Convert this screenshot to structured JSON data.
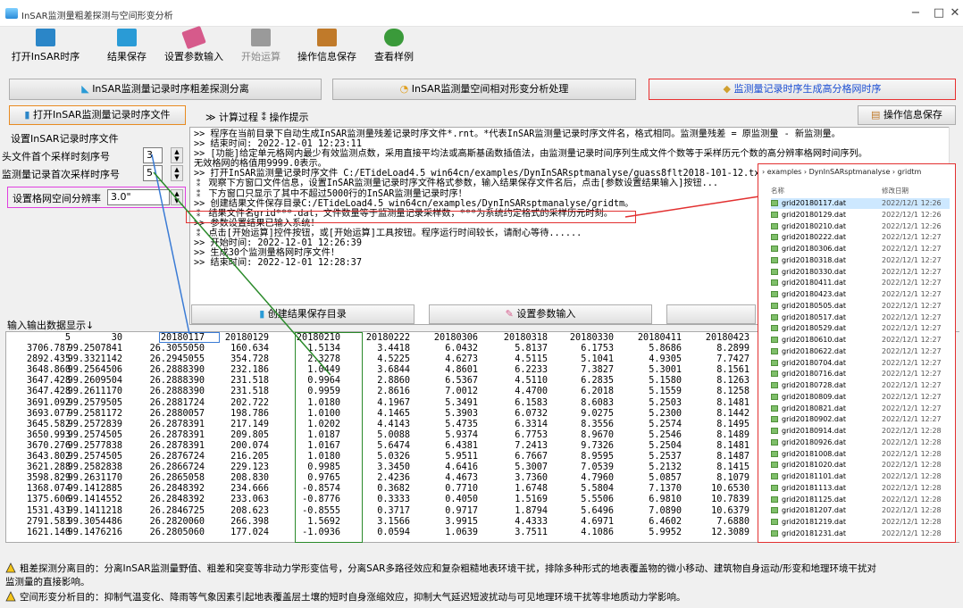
{
  "window": {
    "title": "InSAR监测量粗差探测与空间形变分析",
    "min": "−",
    "max": "□",
    "close": "✕"
  },
  "toolbar": [
    {
      "label": "打开InSAR时序",
      "icon": "book-icon",
      "color": "#2b86c8",
      "disabled": false
    },
    {
      "label": "结果保存",
      "icon": "save-icon",
      "color": "#2a9bd6",
      "disabled": false
    },
    {
      "label": "设置参数输入",
      "icon": "pencil-icon",
      "color": "#d65a8b",
      "disabled": false
    },
    {
      "label": "开始运算",
      "icon": "run-icon",
      "color": "#9a9a9a",
      "disabled": true
    },
    {
      "label": "操作信息保存",
      "icon": "doc-save-icon",
      "color": "#c07a2a",
      "disabled": false
    },
    {
      "label": "查看样例",
      "icon": "people-icon",
      "color": "#3a9a3a",
      "disabled": false
    }
  ],
  "tabs": [
    {
      "label": "InSAR监测量记录时序粗差探测分离"
    },
    {
      "label": "InSAR监测量空间相对形变分析处理"
    },
    {
      "label": "监测量记录时序生成高分格网时序"
    }
  ],
  "panel": {
    "open_button": "打开InSAR监测量记录时序文件",
    "breadcrumb": "≫ 计算过程 ⁑ 操作提示",
    "save_info_button": "操作信息保存",
    "section_title": "设置InSAR记录时序文件",
    "first_label": "头文件首个采样时刻序号",
    "first_value": "3",
    "second_label": "监测量记录首次采样时序号",
    "second_value": "5",
    "resolution_label": "设置格网空间分辨率",
    "resolution_value": "3.0\"",
    "io_label": "输入输出数据显示↓",
    "create_dir_button": "创建结果保存目录",
    "set_param_button": "设置参数输入"
  },
  "log": [
    ">> 程序在当前目录下自动生成InSAR监测量残差记录时序文件*.rnt。*代表InSAR监测量记录时序文件名，格式相同。监测量残差 = 原监测量 - 新监测量。",
    ">> 结束时间: 2022-12-01 12:23:11",
    ">> [功能]给定单元格网内最少有效监测点数，采用直接平均法或高斯基函数插值法，由监测量记录时间序列生成文件个数等于采样历元个数的高分辨率格网时间序列。",
    "无效格网的格值用9999.0表示。",
    ">> 打开InSAR监测量记录时序文件 C:/ETideLoad4.5_win64cn/examples/DynInSARsptmanalyse/guass8flt2018-101-12.txt。",
    " ⁑ 观察下方窗口文件信息，设置InSAR监测量记录时序文件格式参数，输入结果保存文件名后，点击[参数设置结果输入]按钮...",
    " ⁑ 下方窗口只显示了其中不超过5000行的InSAR监测量记录时序！",
    ">> 创建结果文件保存目录C:/ETideLoad4.5_win64cn/examples/DynInSARsptmanalyse/gridtm。",
    " ⁑ 结果文件名grid***.dat，文件数量等于监测量记录采样数，***为系统约定格式的采样历元时刻。",
    ">> 参数设置结果已输入系统！",
    " ⁑ 点击[开始运算]控件按钮，或[开始运算]工具按钮。程序运行时间较长，请耐心等待......",
    ">> 开始时间: 2022-12-01 12:26:39",
    ">> 生成30个监测量格网时序文件！",
    ">> 结束时间: 2022-12-01 12:28:37"
  ],
  "table": {
    "header": [
      "5",
      "30",
      "20180117",
      "20180129",
      "20180210",
      "20180222",
      "20180306",
      "20180318",
      "20180330",
      "20180411",
      "20180423"
    ],
    "rows": [
      [
        "3706.787",
        "99.2507841",
        "26.3055050",
        "160.634",
        "1.5134",
        "3.4418",
        "6.0432",
        "5.8137",
        "6.1753",
        "5.8686",
        "8.2899"
      ],
      [
        "2892.435",
        "99.3321142",
        "26.2945055",
        "354.728",
        "2.3278",
        "4.5225",
        "4.6273",
        "4.5115",
        "5.1041",
        "4.9305",
        "7.7427"
      ],
      [
        "3648.860",
        "99.2564506",
        "26.2888390",
        "232.186",
        "1.0449",
        "3.6844",
        "4.8601",
        "6.2233",
        "7.3827",
        "5.3001",
        "8.1561"
      ],
      [
        "3647.428",
        "99.2609504",
        "26.2888390",
        "231.518",
        "0.9964",
        "2.8860",
        "6.5367",
        "4.5110",
        "6.2835",
        "5.1580",
        "8.1263"
      ],
      [
        "3647.428",
        "99.2611170",
        "26.2888390",
        "231.518",
        "0.9959",
        "2.8616",
        "7.0012",
        "4.4700",
        "6.2018",
        "5.1559",
        "8.1258"
      ],
      [
        "3691.092",
        "99.2579505",
        "26.2881724",
        "202.722",
        "1.0180",
        "4.1967",
        "5.3491",
        "6.1583",
        "8.6083",
        "5.2503",
        "8.1481"
      ],
      [
        "3693.077",
        "99.2581172",
        "26.2880057",
        "198.786",
        "1.0100",
        "4.1465",
        "5.3903",
        "6.0732",
        "9.0275",
        "5.2300",
        "8.1442"
      ],
      [
        "3645.582",
        "99.2572839",
        "26.2878391",
        "217.149",
        "1.0202",
        "4.4143",
        "5.4735",
        "6.3314",
        "8.3556",
        "5.2574",
        "8.1495"
      ],
      [
        "3650.993",
        "99.2574505",
        "26.2878391",
        "209.805",
        "1.0187",
        "5.0088",
        "5.9374",
        "6.7753",
        "8.9670",
        "5.2546",
        "8.1489"
      ],
      [
        "3670.276",
        "99.2577838",
        "26.2878391",
        "200.074",
        "1.0167",
        "5.6474",
        "6.4381",
        "7.2413",
        "9.7326",
        "5.2504",
        "8.1481"
      ],
      [
        "3643.802",
        "99.2574505",
        "26.2876724",
        "216.205",
        "1.0180",
        "5.0326",
        "5.9511",
        "6.7667",
        "8.9595",
        "5.2537",
        "8.1487"
      ],
      [
        "3621.288",
        "99.2582838",
        "26.2866724",
        "229.123",
        "0.9985",
        "3.3450",
        "4.6416",
        "5.3007",
        "7.0539",
        "5.2132",
        "8.1415"
      ],
      [
        "3598.829",
        "99.2631170",
        "26.2865058",
        "208.830",
        "0.9765",
        "2.4236",
        "4.4673",
        "3.7360",
        "4.7960",
        "5.0857",
        "8.1079"
      ],
      [
        "1368.074",
        "99.1412885",
        "26.2848392",
        "234.666",
        "-0.8574",
        "0.3682",
        "0.7710",
        "1.6748",
        "5.5804",
        "7.1370",
        "10.6530"
      ],
      [
        "1375.606",
        "99.1414552",
        "26.2848392",
        "233.063",
        "-0.8776",
        "0.3333",
        "0.4050",
        "1.5169",
        "5.5506",
        "6.9810",
        "10.7839"
      ],
      [
        "1531.431",
        "99.1411218",
        "26.2846725",
        "208.623",
        "-0.8555",
        "0.3717",
        "0.9717",
        "1.8794",
        "5.6496",
        "7.0890",
        "10.6379"
      ],
      [
        "2791.583",
        "99.3054486",
        "26.2820060",
        "266.398",
        "1.5692",
        "3.1566",
        "3.9915",
        "4.4333",
        "4.6971",
        "6.4602",
        "7.6880"
      ],
      [
        "1621.140",
        "99.1476216",
        "26.2805060",
        "177.024",
        "-1.0936",
        "0.0594",
        "1.0639",
        "3.7511",
        "4.1086",
        "5.9952",
        "12.3089"
      ]
    ]
  },
  "filepanel": {
    "breadcrumb": "› examples › DynInSARsptmanalyse › gridtm",
    "col_name": "名称",
    "col_date": "修改日期",
    "files": [
      {
        "name": "grid20180117.dat",
        "date": "2022/12/1 12:26"
      },
      {
        "name": "grid20180129.dat",
        "date": "2022/12/1 12:26"
      },
      {
        "name": "grid20180210.dat",
        "date": "2022/12/1 12:26"
      },
      {
        "name": "grid20180222.dat",
        "date": "2022/12/1 12:27"
      },
      {
        "name": "grid20180306.dat",
        "date": "2022/12/1 12:27"
      },
      {
        "name": "grid20180318.dat",
        "date": "2022/12/1 12:27"
      },
      {
        "name": "grid20180330.dat",
        "date": "2022/12/1 12:27"
      },
      {
        "name": "grid20180411.dat",
        "date": "2022/12/1 12:27"
      },
      {
        "name": "grid20180423.dat",
        "date": "2022/12/1 12:27"
      },
      {
        "name": "grid20180505.dat",
        "date": "2022/12/1 12:27"
      },
      {
        "name": "grid20180517.dat",
        "date": "2022/12/1 12:27"
      },
      {
        "name": "grid20180529.dat",
        "date": "2022/12/1 12:27"
      },
      {
        "name": "grid20180610.dat",
        "date": "2022/12/1 12:27"
      },
      {
        "name": "grid20180622.dat",
        "date": "2022/12/1 12:27"
      },
      {
        "name": "grid20180704.dat",
        "date": "2022/12/1 12:27"
      },
      {
        "name": "grid20180716.dat",
        "date": "2022/12/1 12:27"
      },
      {
        "name": "grid20180728.dat",
        "date": "2022/12/1 12:27"
      },
      {
        "name": "grid20180809.dat",
        "date": "2022/12/1 12:27"
      },
      {
        "name": "grid20180821.dat",
        "date": "2022/12/1 12:27"
      },
      {
        "name": "grid20180902.dat",
        "date": "2022/12/1 12:27"
      },
      {
        "name": "grid20180914.dat",
        "date": "2022/12/1 12:28"
      },
      {
        "name": "grid20180926.dat",
        "date": "2022/12/1 12:28"
      },
      {
        "name": "grid20181008.dat",
        "date": "2022/12/1 12:28"
      },
      {
        "name": "grid20181020.dat",
        "date": "2022/12/1 12:28"
      },
      {
        "name": "grid20181101.dat",
        "date": "2022/12/1 12:28"
      },
      {
        "name": "grid20181113.dat",
        "date": "2022/12/1 12:28"
      },
      {
        "name": "grid20181125.dat",
        "date": "2022/12/1 12:28"
      },
      {
        "name": "grid20181207.dat",
        "date": "2022/12/1 12:28"
      },
      {
        "name": "grid20181219.dat",
        "date": "2022/12/1 12:28"
      },
      {
        "name": "grid20181231.dat",
        "date": "2022/12/1 12:28"
      }
    ]
  },
  "notes": [
    "粗差探测分离目的：分离InSAR监测量野值、粗差和突变等非动力学形变信号，分离SAR多路径效应和复杂粗糙地表环境干扰，排除多种形式的地表覆盖物的微小移动、建筑物自身运动/形变和地理环境干扰对",
    "监测量的直接影响。",
    "空间形变分析目的：抑制气温变化、降雨等气象因素引起地表覆盖层土壤的短时自身涨缩效应，抑制大气延迟短波扰动与可见地理环境干扰等非地质动力学影响。"
  ]
}
